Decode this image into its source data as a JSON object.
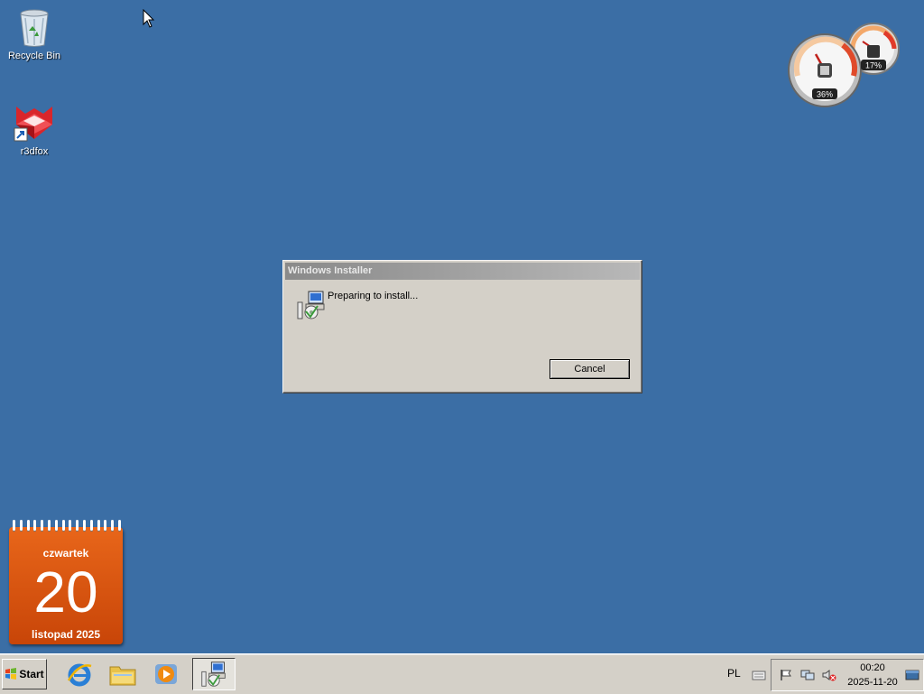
{
  "desktop": {
    "icons": [
      {
        "label": "Recycle Bin",
        "icon": "recycle-bin-icon"
      },
      {
        "label": "r3dfox",
        "icon": "r3dfox-icon"
      }
    ],
    "background": "#3b6ea5"
  },
  "gadgets": {
    "cpu_meter": {
      "cpu_percent": "36%",
      "memory_percent": "17%"
    },
    "calendar": {
      "weekday": "czwartek",
      "day": "20",
      "month_year": "listopad 2025"
    }
  },
  "dialog": {
    "title": "Windows Installer",
    "message": "Preparing to install...",
    "cancel_label": "Cancel",
    "icon": "installer-icon"
  },
  "taskbar": {
    "start_label": "Start",
    "quick_launch": [
      "internet-explorer-icon",
      "explorer-icon",
      "media-player-icon"
    ],
    "language": "PL",
    "clock": {
      "time": "00:20",
      "date": "2025-11-20"
    },
    "tray_icons": [
      "keyboard-icon",
      "flag-icon",
      "network-icon",
      "volume-muted-icon",
      "show-desktop-icon"
    ]
  }
}
